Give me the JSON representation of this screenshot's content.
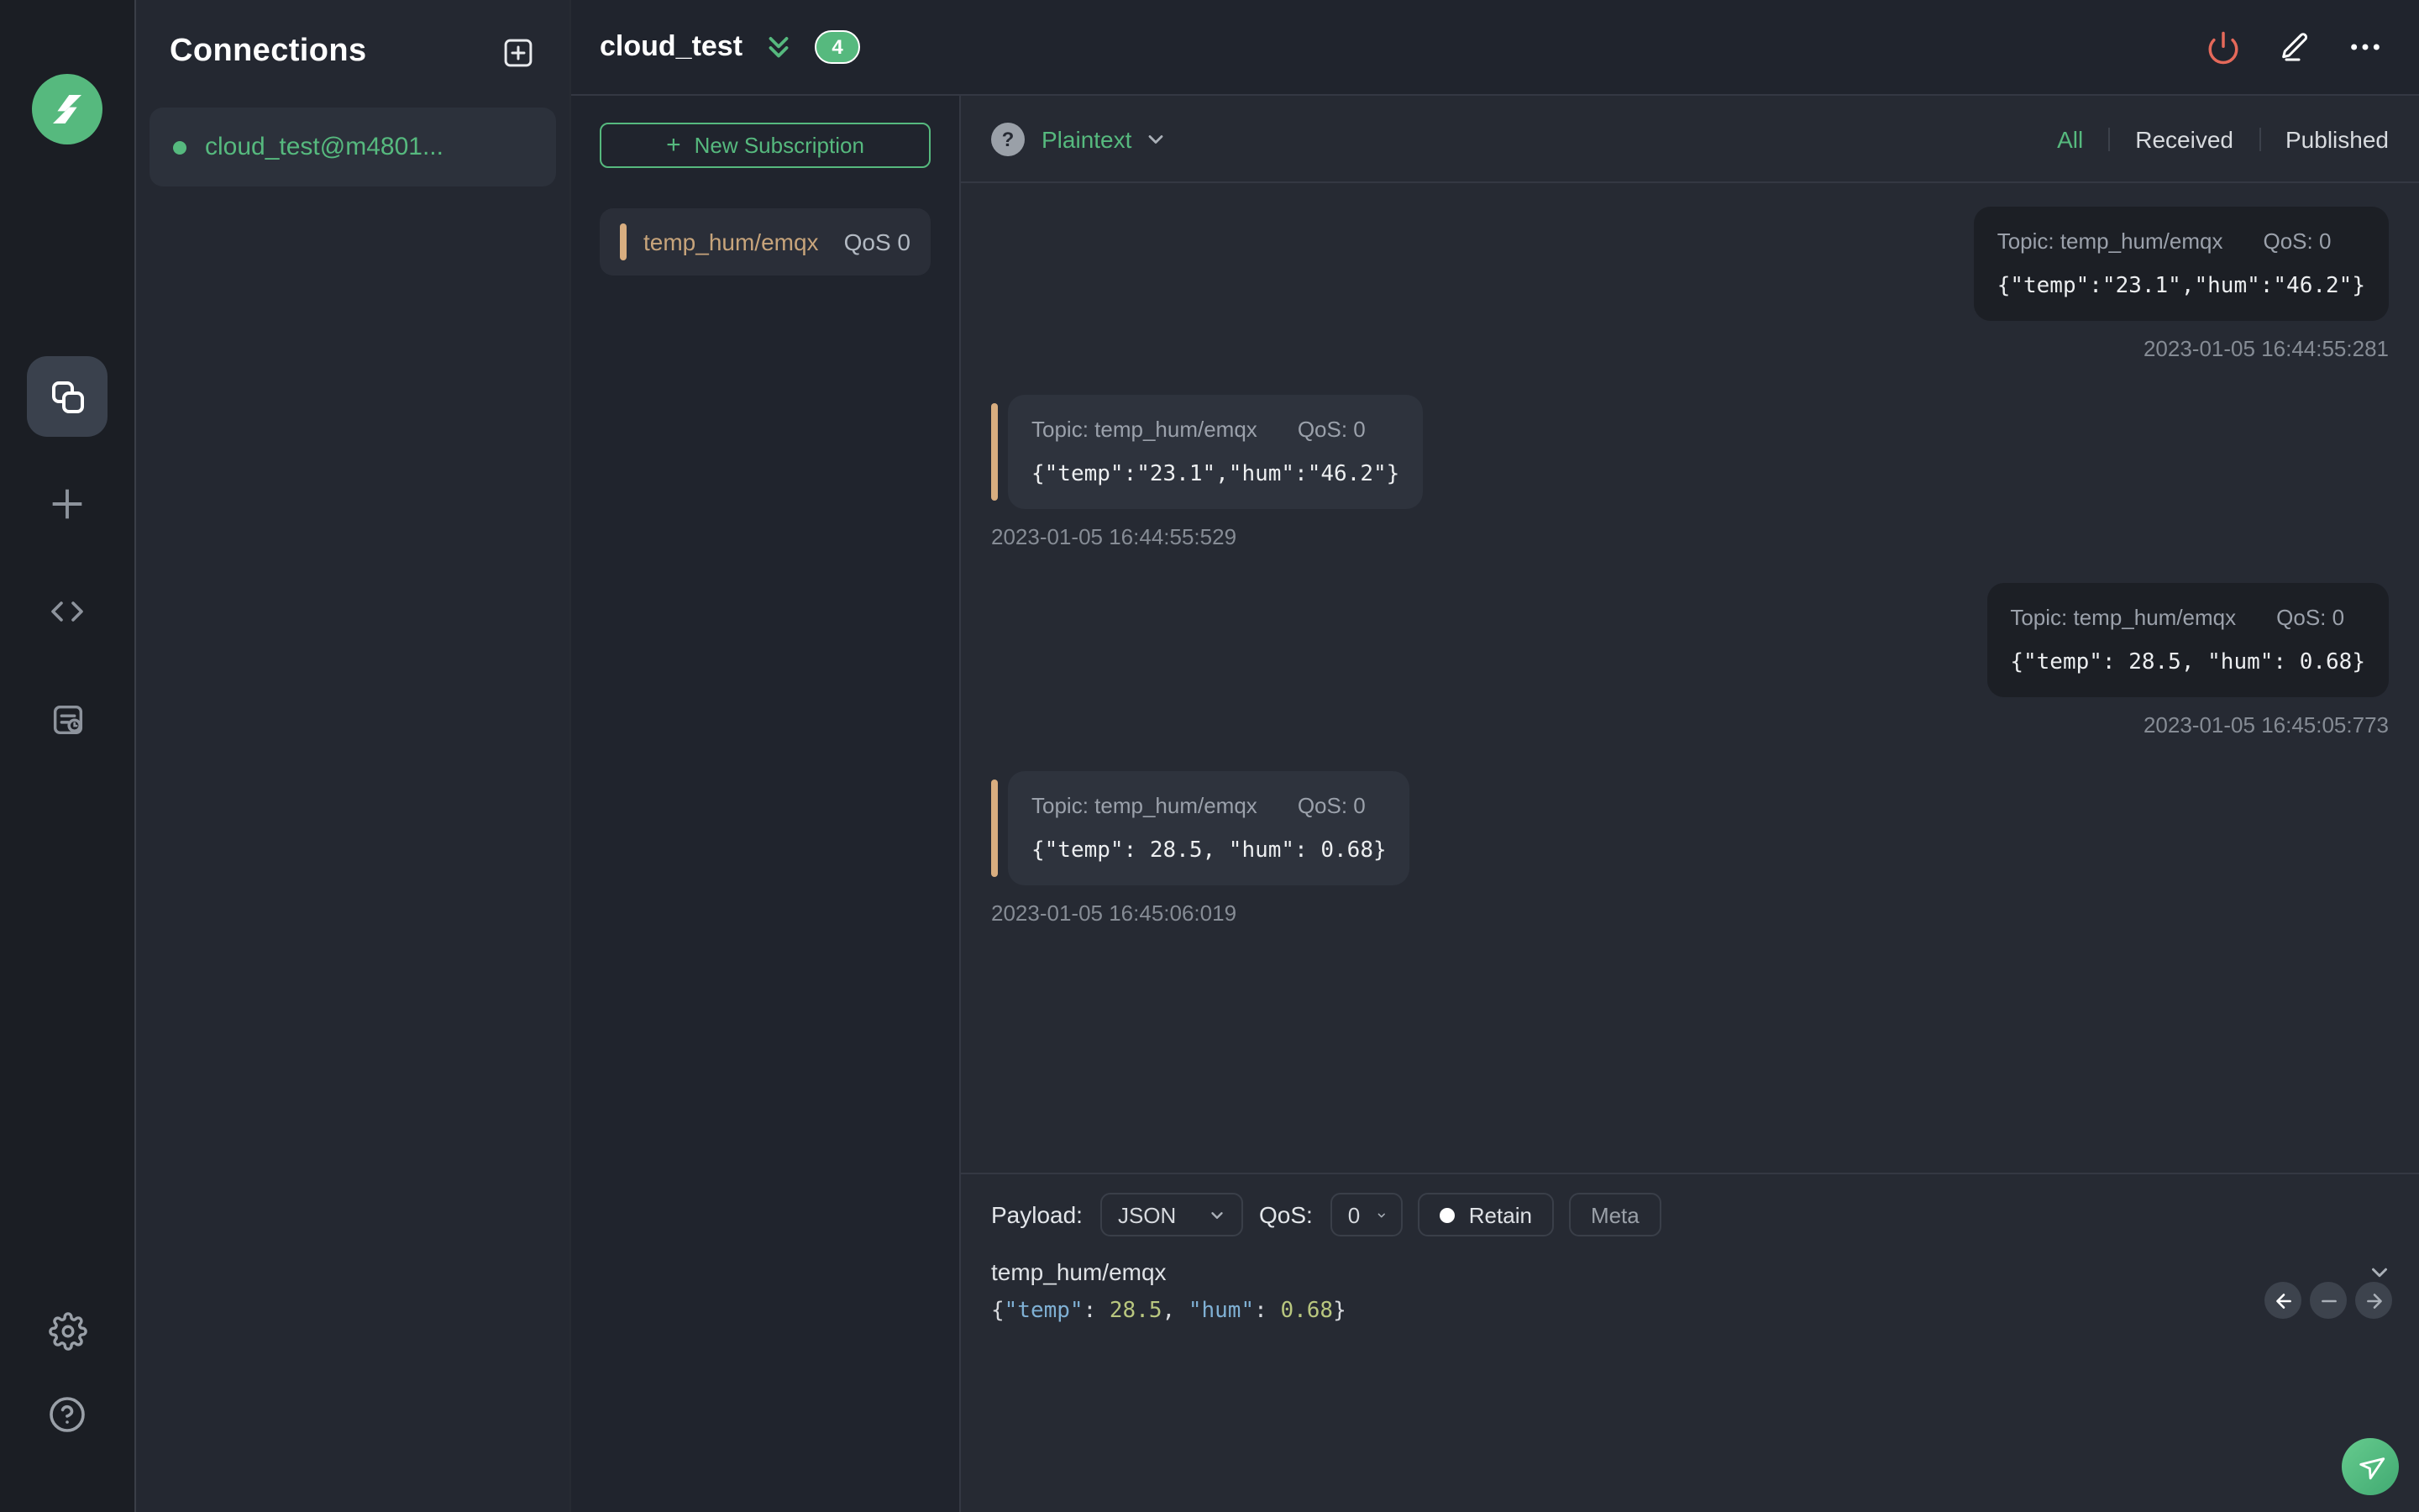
{
  "colors": {
    "green": "#56b97e",
    "tan-bar": "#d9ae80",
    "tan-text": "#c7a47b",
    "power-red": "#e5695a"
  },
  "connections_panel": {
    "title": "Connections",
    "items": [
      {
        "name": "cloud_test@m4801...",
        "status": "connected"
      }
    ]
  },
  "topbar": {
    "connection_title": "cloud_test",
    "unread_badge": "4"
  },
  "subscriptions_panel": {
    "new_subscription_label": "New Subscription",
    "new_subscription_plus": "+",
    "subscriptions": [
      {
        "topic": "temp_hum/emqx",
        "qos_label": "QoS 0"
      }
    ]
  },
  "messages_panel": {
    "help_glyph": "?",
    "view_mode": "Plaintext",
    "filters": {
      "all": "All",
      "received": "Received",
      "published": "Published",
      "active": "All"
    },
    "messages": [
      {
        "direction": "published",
        "topic_label": "Topic: temp_hum/emqx",
        "qos_label": "QoS: 0",
        "payload": "{\"temp\":\"23.1\",\"hum\":\"46.2\"}",
        "timestamp": "2023-01-05 16:44:55:281"
      },
      {
        "direction": "received",
        "topic_label": "Topic: temp_hum/emqx",
        "qos_label": "QoS: 0",
        "payload": "{\"temp\":\"23.1\",\"hum\":\"46.2\"}",
        "timestamp": "2023-01-05 16:44:55:529"
      },
      {
        "direction": "published",
        "topic_label": "Topic: temp_hum/emqx",
        "qos_label": "QoS: 0",
        "payload": "{\"temp\": 28.5, \"hum\": 0.68}",
        "timestamp": "2023-01-05 16:45:05:773"
      },
      {
        "direction": "received",
        "topic_label": "Topic: temp_hum/emqx",
        "qos_label": "QoS: 0",
        "payload": "{\"temp\": 28.5, \"hum\": 0.68}",
        "timestamp": "2023-01-05 16:45:06:019"
      }
    ]
  },
  "composer": {
    "payload_label": "Payload:",
    "payload_format": "JSON",
    "qos_label": "QoS:",
    "qos_value": "0",
    "retain_label": "Retain",
    "meta_label": "Meta",
    "topic": "temp_hum/emqx",
    "payload_segments": [
      {
        "text": "{",
        "type": "punct"
      },
      {
        "text": "\"temp\"",
        "type": "key"
      },
      {
        "text": ": ",
        "type": "punct"
      },
      {
        "text": "28.5",
        "type": "num"
      },
      {
        "text": ", ",
        "type": "punct"
      },
      {
        "text": "\"hum\"",
        "type": "key"
      },
      {
        "text": ": ",
        "type": "punct"
      },
      {
        "text": "0.68",
        "type": "num"
      },
      {
        "text": "}",
        "type": "punct"
      }
    ]
  }
}
